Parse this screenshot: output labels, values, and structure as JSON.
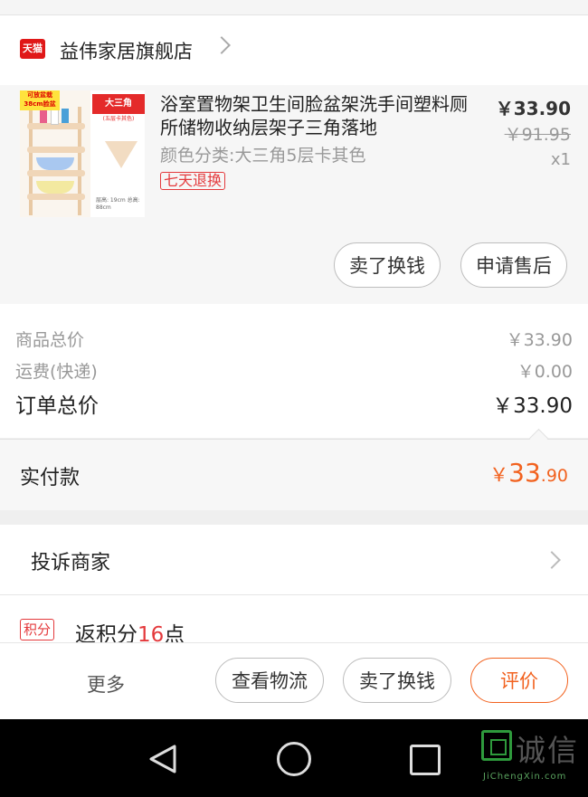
{
  "store": {
    "badge": "天猫",
    "name": "益伟家居旗舰店"
  },
  "product": {
    "thumb_tag": "可放盆栽38cm脸盆",
    "thumb_red_label": "大三角",
    "thumb_red_sub": "(五层卡其色)",
    "thumb_caption": "层高: 19cm 总高: 88cm",
    "title": "浴室置物架卫生间脸盆架洗手间塑料厕所储物收纳层架子三角落地",
    "spec": "颜色分类:大三角5层卡其色",
    "return_tag": "七天退换",
    "price": "￥33.90",
    "original_price": "￥91.95",
    "qty": "x1",
    "buttons": {
      "sell": "卖了换钱",
      "after_sale": "申请售后"
    }
  },
  "summary": {
    "goods_label": "商品总价",
    "goods_value": "￥33.90",
    "shipping_label": "运费(快递)",
    "shipping_value": "￥0.00",
    "total_label": "订单总价",
    "total_value": "￥33.90"
  },
  "paid": {
    "label": "实付款",
    "currency": "￥",
    "integer": "33",
    "decimal": ".90"
  },
  "complain": {
    "label": "投诉商家"
  },
  "points": {
    "badge": "积分",
    "prefix": "返积分",
    "amount": "16",
    "suffix": "点"
  },
  "actions": {
    "more": "更多",
    "logistics": "查看物流",
    "sell": "卖了换钱",
    "rate": "评价"
  },
  "watermark": {
    "text": "诚信",
    "sub": "JiChengXin.com"
  },
  "colors": {
    "accent": "#f2621f",
    "tag_red": "#e4393c",
    "tmall_red": "#e01818"
  }
}
